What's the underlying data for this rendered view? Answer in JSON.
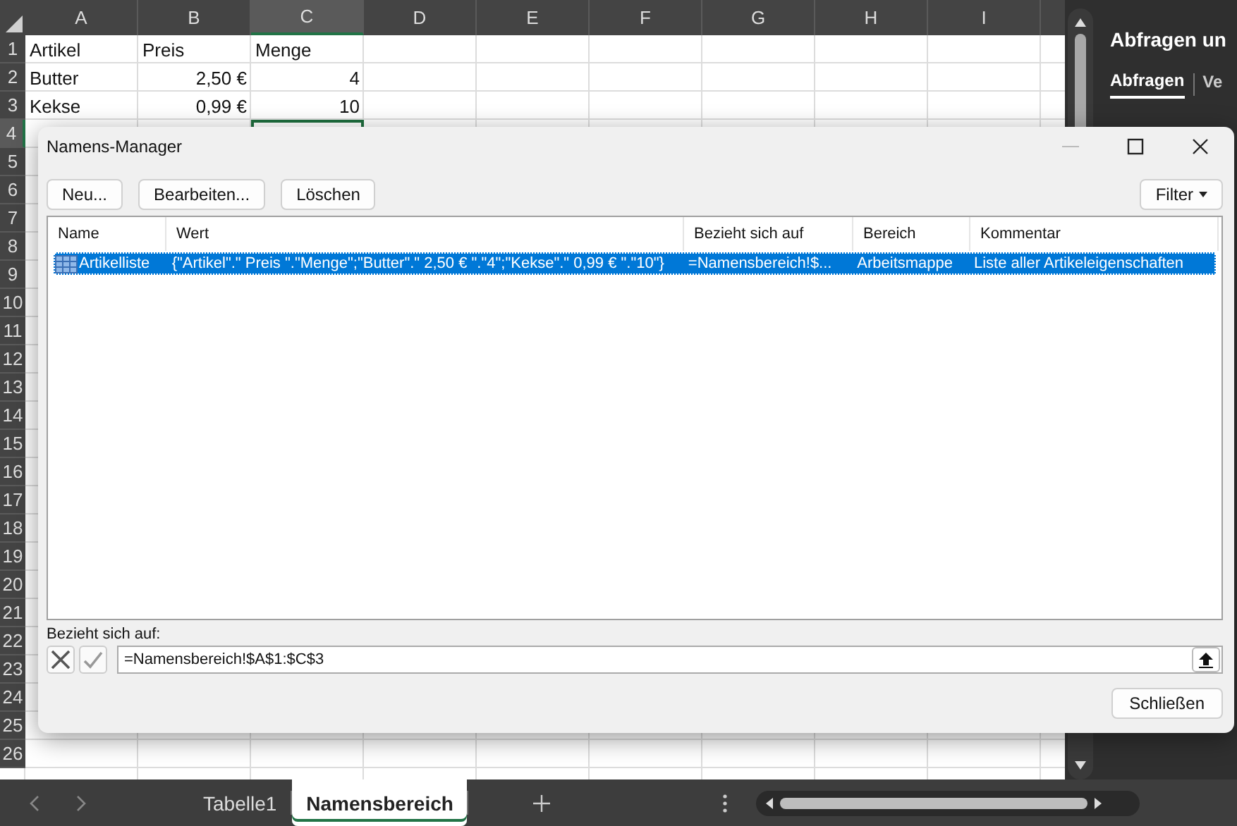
{
  "sheet": {
    "columns": [
      {
        "label": "A",
        "selected": false
      },
      {
        "label": "B",
        "selected": false
      },
      {
        "label": "C",
        "selected": true
      },
      {
        "label": "D",
        "selected": false
      },
      {
        "label": "E",
        "selected": false
      },
      {
        "label": "F",
        "selected": false
      },
      {
        "label": "G",
        "selected": false
      },
      {
        "label": "H",
        "selected": false
      },
      {
        "label": "I",
        "selected": false
      }
    ],
    "rows": [
      {
        "label": "1",
        "selected": false,
        "cells": [
          {
            "text": "Artikel",
            "kind": "text"
          },
          {
            "text": "Preis",
            "kind": "text"
          },
          {
            "text": "Menge",
            "kind": "text"
          }
        ]
      },
      {
        "label": "2",
        "selected": false,
        "cells": [
          {
            "text": "Butter",
            "kind": "text"
          },
          {
            "text": "2,50 €",
            "kind": "number"
          },
          {
            "text": "4",
            "kind": "number"
          }
        ]
      },
      {
        "label": "3",
        "selected": false,
        "cells": [
          {
            "text": "Kekse",
            "kind": "text"
          },
          {
            "text": "0,99 €",
            "kind": "number"
          },
          {
            "text": "10",
            "kind": "number"
          }
        ]
      },
      {
        "label": "4",
        "selected": true
      },
      {
        "label": "5",
        "selected": false
      },
      {
        "label": "6",
        "selected": false
      },
      {
        "label": "7",
        "selected": false
      },
      {
        "label": "8",
        "selected": false
      },
      {
        "label": "9",
        "selected": false
      },
      {
        "label": "10",
        "selected": false
      },
      {
        "label": "11",
        "selected": false
      },
      {
        "label": "12",
        "selected": false
      },
      {
        "label": "13",
        "selected": false
      },
      {
        "label": "14",
        "selected": false
      },
      {
        "label": "15",
        "selected": false
      },
      {
        "label": "16",
        "selected": false
      },
      {
        "label": "17",
        "selected": false
      },
      {
        "label": "18",
        "selected": false
      },
      {
        "label": "19",
        "selected": false
      },
      {
        "label": "20",
        "selected": false
      },
      {
        "label": "21",
        "selected": false
      },
      {
        "label": "22",
        "selected": false
      },
      {
        "label": "23",
        "selected": false
      },
      {
        "label": "24",
        "selected": false
      },
      {
        "label": "25",
        "selected": false
      },
      {
        "label": "26",
        "selected": false
      }
    ]
  },
  "side_pane": {
    "title": "Abfragen un",
    "tabs": [
      {
        "label": "Abfragen",
        "selected": true
      },
      {
        "label": "Ve",
        "selected": false
      }
    ]
  },
  "sheet_tabs": [
    {
      "label": "Tabelle1",
      "selected": false
    },
    {
      "label": "Namensbereich",
      "selected": true
    }
  ],
  "dialog": {
    "title": "Namens-Manager",
    "buttons": [
      {
        "label": "Neu..."
      },
      {
        "label": "Bearbeiten..."
      },
      {
        "label": "Löschen"
      }
    ],
    "filter_button": {
      "label": "Filter"
    },
    "columns": [
      "Name",
      "Wert",
      "Bezieht sich auf",
      "Bereich",
      "Kommentar"
    ],
    "names": [
      {
        "name": "Artikelliste",
        "value": "{\"Artikel\".\" Preis \".\"Menge\";\"Butter\".\" 2,50 € \".\"4\";\"Kekse\".\" 0,99 € \".\"10\"}",
        "refers_to": "=Namensbereich!$...",
        "scope": "Arbeitsmappe",
        "comment": "Liste aller Artikeleigenschaften",
        "selected": true
      }
    ],
    "refers_label": {
      "label": "Bezieht sich auf:"
    },
    "refers_value": "=Namensbereich!$A$1:$C$3",
    "close_button": "Schließen"
  }
}
